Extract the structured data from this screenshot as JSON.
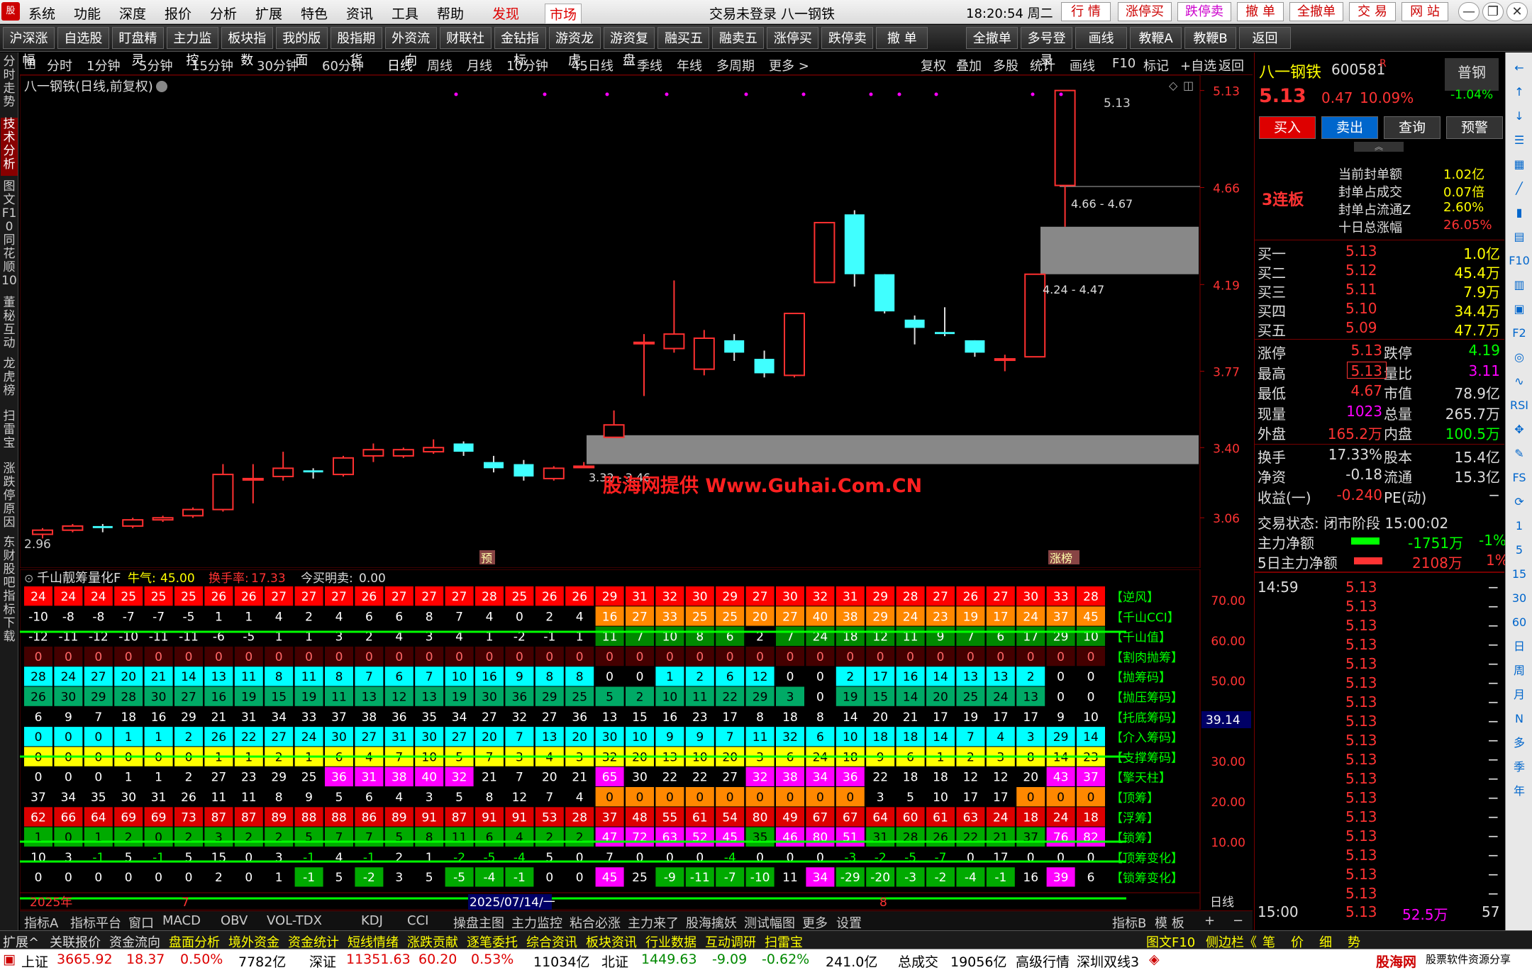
{
  "menubar": {
    "items": [
      "系统",
      "功能",
      "深度",
      "报价",
      "分析",
      "扩展",
      "特色",
      "资讯",
      "工具",
      "帮助"
    ],
    "discover": "发现",
    "market": "市场",
    "title": "交易未登录  八一钢铁",
    "time": "18:20:54 周二",
    "right_buttons": [
      "行 情",
      "涨停买",
      "跌停卖",
      "撤 单",
      "全撤单",
      "交 易",
      "网 站"
    ]
  },
  "toolbar": {
    "buttons": [
      "沪深涨幅",
      "自选股",
      "盯盘精灵",
      "主力监控",
      "板块指数",
      "我的版面",
      "股指期货",
      "外资流向",
      "财联社",
      "金钻指标",
      "游资龙虎",
      "游资复盘",
      "融买五",
      "融卖五",
      "涨停买",
      "跌停卖",
      "撤 单",
      "全撤单",
      "多号登录",
      "画线",
      "教鞭A",
      "教鞭B",
      "返回"
    ]
  },
  "lefttabs": [
    "分时走势",
    "技术分析",
    "图文F10",
    "同花顺10",
    "董秘互动",
    "龙虎榜",
    "扫雷宝",
    "涨跌停原因",
    "东财股吧",
    "指标下载"
  ],
  "periodbar": {
    "items": [
      "分时",
      "1分钟",
      "5分钟",
      "15分钟",
      "30分钟",
      "60分钟",
      "日线",
      "周线",
      "月线",
      "10分钟",
      "45日线",
      "季线",
      "年线",
      "多周期",
      "更多 >"
    ],
    "active": "日线",
    "right_items": [
      "复权",
      "叠加",
      "多股",
      "统计",
      "画线",
      "F10",
      "标记",
      "+自选",
      "返回"
    ]
  },
  "chart": {
    "label": "八一钢铁(日线,前复权)",
    "price_ticks": [
      "5.13",
      "4.66",
      "4.19",
      "3.77",
      "3.40",
      "3.06"
    ],
    "low_label": "2.96",
    "high_label": "5.13",
    "gap1": "4.66 - 4.67",
    "gap2": "4.24 - 4.47",
    "gap3": "3.32 - 3.46",
    "watermark": "股海网提供 Www.Guhai.Com.CN",
    "mark_pre": "预",
    "mark_zt": "涨榜",
    "candles": [
      [
        2.98,
        3.0,
        2.96,
        3.01
      ],
      [
        3.0,
        3.02,
        2.99,
        3.03
      ],
      [
        3.02,
        3.01,
        2.99,
        3.03
      ],
      [
        3.02,
        3.05,
        3.01,
        3.06
      ],
      [
        3.05,
        3.06,
        3.04,
        3.07
      ],
      [
        3.07,
        3.1,
        3.06,
        3.11
      ],
      [
        3.1,
        3.27,
        3.09,
        3.32
      ],
      [
        3.25,
        3.25,
        3.13,
        3.32
      ],
      [
        3.26,
        3.3,
        3.24,
        3.38
      ],
      [
        3.29,
        3.28,
        3.25,
        3.3
      ],
      [
        3.27,
        3.35,
        3.26,
        3.36
      ],
      [
        3.36,
        3.39,
        3.33,
        3.42
      ],
      [
        3.36,
        3.39,
        3.35,
        3.4
      ],
      [
        3.38,
        3.4,
        3.37,
        3.44
      ],
      [
        3.42,
        3.38,
        3.36,
        3.43
      ],
      [
        3.33,
        3.3,
        3.28,
        3.36
      ],
      [
        3.32,
        3.26,
        3.24,
        3.34
      ],
      [
        3.25,
        3.3,
        3.24,
        3.31
      ],
      [
        3.31,
        3.31,
        3.3,
        3.33
      ],
      [
        3.45,
        3.51,
        3.45,
        3.58
      ],
      [
        3.91,
        3.91,
        3.65,
        3.95
      ],
      [
        3.88,
        3.95,
        3.86,
        4.21
      ],
      [
        3.78,
        3.93,
        3.75,
        3.97
      ],
      [
        3.92,
        3.86,
        3.82,
        3.95
      ],
      [
        3.83,
        3.76,
        3.74,
        3.87
      ],
      [
        3.75,
        4.05,
        3.74,
        4.05
      ],
      [
        4.2,
        4.49,
        4.2,
        4.49
      ],
      [
        4.53,
        4.24,
        4.18,
        4.55
      ],
      [
        4.24,
        4.06,
        4.05,
        4.24
      ],
      [
        4.02,
        3.98,
        3.9,
        4.04
      ],
      [
        3.96,
        3.95,
        3.94,
        4.08
      ],
      [
        3.92,
        3.86,
        3.84,
        3.92
      ],
      [
        3.83,
        3.83,
        3.77,
        3.85
      ],
      [
        3.84,
        4.24,
        3.84,
        4.24
      ],
      [
        4.67,
        5.13,
        4.47,
        5.13
      ]
    ]
  },
  "indicator": {
    "name": "千山靓筹量化F",
    "qi_label": "牛气:",
    "qi": "45.00",
    "hs_label": "换手率:",
    "hs": "17.33",
    "buy_label": "今买明卖:",
    "buy": "0.00",
    "ticks": [
      "70.00",
      "60.00",
      "50.00",
      "40.00",
      "30.00",
      "20.00",
      "10.00"
    ],
    "cursor_val": "39.14",
    "rows": [
      [
        "【逆风】",
        "#ff0000",
        "#fff",
        [
          24,
          24,
          24,
          25,
          25,
          25,
          26,
          26,
          27,
          27,
          27,
          26,
          27,
          27,
          27,
          28,
          25,
          26,
          26,
          29,
          31,
          32,
          30,
          29,
          27,
          30,
          32,
          31,
          29,
          28,
          27,
          26,
          27,
          30,
          33,
          28
        ]
      ],
      [
        "【千山CCI】",
        "#000",
        "#fff",
        [
          -10,
          -8,
          -8,
          -7,
          -7,
          -5,
          1,
          1,
          4,
          2,
          4,
          6,
          6,
          8,
          7,
          4,
          0,
          2,
          4,
          16,
          27,
          33,
          25,
          25,
          20,
          27,
          40,
          38,
          29,
          24,
          23,
          19,
          17,
          24,
          37,
          45
        ]
      ],
      [
        "【千山值】",
        "#000",
        "#fff",
        [
          -12,
          -11,
          -12,
          -10,
          -11,
          -11,
          -6,
          -5,
          1,
          1,
          3,
          2,
          4,
          3,
          4,
          1,
          -2,
          -1,
          1,
          11,
          7,
          10,
          8,
          6,
          2,
          7,
          24,
          18,
          12,
          11,
          9,
          7,
          6,
          17,
          29,
          10
        ]
      ],
      [
        "【割肉抛筹】",
        "#600",
        "#f66",
        [
          0,
          0,
          0,
          0,
          0,
          0,
          0,
          0,
          0,
          0,
          0,
          0,
          0,
          0,
          0,
          0,
          0,
          0,
          0,
          0,
          0,
          0,
          0,
          0,
          0,
          0,
          0,
          0,
          0,
          0,
          0,
          0,
          0,
          0,
          0,
          0
        ]
      ],
      [
        "【抛筹码】",
        "#0ff",
        "#000",
        [
          28,
          24,
          27,
          20,
          21,
          14,
          13,
          11,
          8,
          11,
          8,
          7,
          6,
          7,
          10,
          16,
          9,
          8,
          8,
          0,
          0,
          1,
          2,
          6,
          12,
          0,
          0,
          2,
          17,
          16,
          14,
          13,
          13,
          2,
          0,
          0
        ]
      ],
      [
        "【抛压筹码】",
        "#0a6",
        "#000",
        [
          26,
          30,
          29,
          28,
          30,
          27,
          16,
          19,
          15,
          19,
          11,
          13,
          12,
          13,
          19,
          30,
          36,
          29,
          25,
          5,
          2,
          10,
          11,
          22,
          29,
          3,
          0,
          19,
          15,
          14,
          20,
          25,
          24,
          13,
          0,
          0
        ]
      ],
      [
        "【托底筹码】",
        "#000",
        "#fff",
        [
          6,
          9,
          7,
          18,
          16,
          29,
          21,
          31,
          34,
          33,
          37,
          38,
          36,
          35,
          34,
          27,
          32,
          27,
          36,
          13,
          15,
          16,
          23,
          17,
          8,
          18,
          8,
          14,
          20,
          21,
          17,
          19,
          17,
          17,
          9,
          10
        ]
      ],
      [
        "【介入筹码】",
        "#0ff",
        "#000",
        [
          0,
          0,
          0,
          1,
          1,
          2,
          26,
          22,
          27,
          24,
          30,
          27,
          31,
          30,
          27,
          20,
          7,
          13,
          20,
          30,
          10,
          9,
          9,
          7,
          11,
          32,
          6,
          10,
          18,
          18,
          14,
          7,
          4,
          3,
          29,
          14
        ]
      ],
      [
        "【支撑筹码】",
        "#ff0",
        "#000",
        [
          0,
          0,
          0,
          0,
          0,
          0,
          1,
          1,
          2,
          1,
          6,
          4,
          7,
          10,
          5,
          7,
          3,
          4,
          3,
          32,
          20,
          13,
          10,
          20,
          3,
          6,
          24,
          18,
          9,
          6,
          1,
          2,
          3,
          8,
          14,
          23
        ]
      ],
      [
        "【擎天柱】",
        "#f0f",
        "#fff",
        [
          0,
          0,
          0,
          1,
          1,
          2,
          27,
          23,
          29,
          25,
          36,
          31,
          38,
          40,
          32,
          21,
          7,
          20,
          21,
          65,
          30,
          22,
          22,
          27,
          32,
          38,
          34,
          36,
          22,
          18,
          18,
          12,
          12,
          20,
          43,
          37
        ]
      ],
      [
        "【顶筹】",
        "#f80",
        "#000",
        [
          37,
          34,
          35,
          30,
          31,
          26,
          11,
          11,
          8,
          9,
          5,
          6,
          4,
          3,
          5,
          8,
          12,
          7,
          4,
          0,
          0,
          0,
          0,
          0,
          0,
          0,
          0,
          0,
          3,
          5,
          10,
          17,
          17,
          0,
          0,
          0
        ]
      ],
      [
        "【浮筹】",
        "#d00",
        "#fff",
        [
          62,
          66,
          64,
          69,
          69,
          73,
          87,
          87,
          89,
          88,
          88,
          86,
          89,
          91,
          87,
          91,
          91,
          53,
          28,
          37,
          48,
          55,
          61,
          54,
          80,
          49,
          67,
          67,
          64,
          60,
          61,
          63,
          24,
          18,
          24,
          18
        ]
      ],
      [
        "【锁筹】",
        "#0a0",
        "#000",
        [
          1,
          0,
          1,
          2,
          0,
          2,
          3,
          2,
          2,
          5,
          7,
          7,
          5,
          8,
          11,
          6,
          4,
          2,
          2,
          47,
          72,
          63,
          52,
          45,
          35,
          46,
          80,
          51,
          31,
          28,
          26,
          22,
          21,
          37,
          76,
          82
        ]
      ],
      [
        "【顶筹变化】",
        "#000",
        "#fff",
        [
          10,
          3,
          -1,
          5,
          -1,
          5,
          15,
          0,
          3,
          -1,
          4,
          -1,
          2,
          1,
          -2,
          -5,
          -4,
          5,
          0,
          7,
          0,
          0,
          0,
          -4,
          0,
          0,
          0,
          -3,
          -2,
          -5,
          -7,
          0,
          17,
          0,
          0,
          0
        ]
      ],
      [
        "【锁筹变化】",
        "#000",
        "#fff",
        [
          0,
          0,
          0,
          0,
          0,
          0,
          2,
          0,
          1,
          -1,
          5,
          -2,
          3,
          5,
          -5,
          -4,
          -1,
          0,
          0,
          45,
          25,
          -9,
          -11,
          -7,
          -10,
          11,
          34,
          -29,
          -20,
          -3,
          -2,
          -4,
          -1,
          16,
          39,
          6
        ]
      ]
    ],
    "date_left": "2025年",
    "date_mid": "2025/07/14/一",
    "date_m7": "7",
    "date_m8": "8",
    "period": "日线"
  },
  "bottomtabs": {
    "left": [
      "指标A",
      "指标平台",
      "窗口",
      "MACD",
      "OBV",
      "VOL-TDX",
      "KDJ",
      "CCI",
      "操盘主图",
      "主力监控",
      "粘合必涨",
      "主力来了",
      "股海擒妖",
      "测试幅图",
      "更多",
      "设置"
    ],
    "right": [
      "指标B",
      "模 板",
      "+",
      "−"
    ]
  },
  "statusbar": {
    "items": [
      "扩展^",
      "关联报价",
      "资金流向",
      "盘面分析",
      "境外资金",
      "资金统计",
      "短线情绪",
      "涨跌贡献",
      "逐笔委托",
      "综合资讯",
      "板块资讯",
      "行业数据",
      "互动调研",
      "扫雷宝"
    ],
    "right": [
      "图文F10",
      "侧边栏《",
      "笔",
      "价",
      "细",
      "势"
    ]
  },
  "statusbar2": {
    "sh_label": "上证",
    "sh": "3665.92",
    "sh_chg": "18.37",
    "sh_pct": "0.50%",
    "sh_amt": "7782亿",
    "sz_label": "深证",
    "sz": "11351.63",
    "sz_chg": "60.20",
    "sz_pct": "0.53%",
    "sz_amt": "11034亿",
    "bz_label": "北证",
    "bz": "1449.63",
    "bz_chg": "-9.09",
    "bz_pct": "-0.62%",
    "bz_amt": "241.0亿",
    "total_label": "总成交",
    "total": "19056亿",
    "adv": "高级行情",
    "conn": "深圳双线3",
    "brand": "股海网",
    "brand_sub": "股票软件资源分享",
    "brand_url": "www.Guhai.com.cn"
  },
  "quote": {
    "name": "八一钢铁",
    "code": "600581",
    "r": "R",
    "type": "普钢",
    "type_pct": "-1.04%",
    "price": "5.13",
    "chg": "0.47",
    "pct": "10.09%",
    "btns": [
      "买入",
      "卖出",
      "查询",
      "预警"
    ],
    "streak": "3连板",
    "seal_labels": [
      "当前封单额",
      "封单占成交",
      "封单占流通Z",
      "十日总涨幅"
    ],
    "seal_vals": [
      "1.02亿",
      "0.07倍",
      "2.60%",
      "26.05%"
    ],
    "bids": [
      [
        "买一",
        "5.13",
        "1.0亿"
      ],
      [
        "买二",
        "5.12",
        "45.4万"
      ],
      [
        "买三",
        "5.11",
        "7.9万"
      ],
      [
        "买四",
        "5.10",
        "34.4万"
      ],
      [
        "买五",
        "5.09",
        "47.7万"
      ]
    ],
    "stats": [
      [
        "涨停",
        "5.13",
        "跌停",
        "4.19"
      ],
      [
        "最高",
        "5.13",
        "量比",
        "3.11"
      ],
      [
        "最低",
        "4.67",
        "市值",
        "78.9亿"
      ],
      [
        "现量",
        "1023",
        "总量",
        "265.7万"
      ],
      [
        "外盘",
        "165.2万",
        "内盘",
        "100.5万"
      ],
      [
        "换手",
        "17.33%",
        "股本",
        "15.4亿"
      ],
      [
        "净资",
        "-0.18",
        "流通",
        "15.3亿"
      ],
      [
        "收益(一)",
        "-0.240",
        "PE(动)",
        "−"
      ]
    ],
    "state": "交易状态: 闭市阶段 15:00:02",
    "main_label": "主力净额",
    "main_val": "-1751万",
    "main_pct": "-1%",
    "m5_label": "5日主力净额",
    "m5_val": "2108万",
    "m5_pct": "1%",
    "ticks_time": "14:59",
    "tick_price": "5.13",
    "tick_dash": "−",
    "last_time": "15:00",
    "last_price": "5.13",
    "last_vol": "52.5万",
    "last_n": "57"
  },
  "rightedge": [
    "←",
    "↑",
    "↓",
    "☰",
    "▦",
    "╱",
    "▮",
    "▤",
    "F10",
    "▥",
    "▣",
    "F2",
    "◎",
    "∿",
    "RSI",
    "✥",
    "✎",
    "FS",
    "⟳",
    "1",
    "5",
    "15",
    "30",
    "60",
    "日",
    "周",
    "月",
    "N",
    "多",
    "季",
    "年"
  ],
  "colors": {
    "up": "#ff3030",
    "down": "#40ffff",
    "bg": "#000000",
    "grid": "#800000"
  }
}
